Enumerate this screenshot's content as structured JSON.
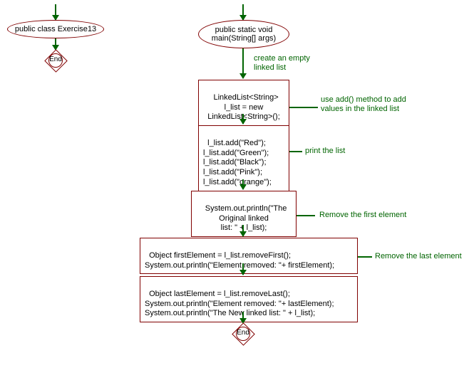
{
  "left": {
    "class_decl": "public class Exercise13",
    "end_label": "End"
  },
  "right": {
    "main_decl": "public static void\nmain(String[] args)",
    "comment_create": "create an empty\nlinked list",
    "node_decl": "LinkedList<String>\nl_list = new\nLinkedList<String>();",
    "comment_add": "use add() method to add\nvalues in the linked list",
    "node_add": "l_list.add(\"Red\");\nl_list.add(\"Green\");\nl_list.add(\"Black\");\nl_list.add(\"Pink\");\nl_list.add(\"orange\");",
    "comment_print": "print the list",
    "node_print": "System.out.println(\"The\nOriginal linked\nlist: \" + l_list);",
    "comment_remove_first": "Remove the first element",
    "node_remove_first": "Object firstElement = l_list.removeFirst();\nSystem.out.println(\"Element removed: \"+ firstElement);",
    "comment_remove_last": "Remove the last element",
    "node_remove_last": "Object lastElement = l_list.removeLast();\nSystem.out.println(\"Element removed: \"+ lastElement);\nSystem.out.println(\"The New linked list: \" + l_list);",
    "end_label": "End"
  }
}
